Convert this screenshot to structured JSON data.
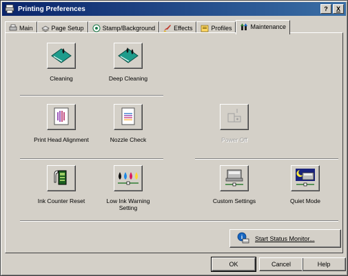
{
  "window": {
    "title": "Printing Preferences"
  },
  "title_buttons": {
    "help": "?",
    "close": "X"
  },
  "tabs": [
    {
      "label": "Main",
      "icon": "printer-icon"
    },
    {
      "label": "Page Setup",
      "icon": "pages-icon"
    },
    {
      "label": "Stamp/Background",
      "icon": "stamp-icon"
    },
    {
      "label": "Effects",
      "icon": "brush-icon"
    },
    {
      "label": "Profiles",
      "icon": "profiles-icon"
    },
    {
      "label": "Maintenance",
      "icon": "tools-icon",
      "active": true
    }
  ],
  "tools": {
    "cleaning": "Cleaning",
    "deep_cleaning": "Deep Cleaning",
    "print_head_alignment": "Print Head Alignment",
    "nozzle_check": "Nozzle Check",
    "power_off": "Power Off",
    "ink_counter_reset": "Ink Counter Reset",
    "low_ink_warning_line1": "Low Ink Warning",
    "low_ink_warning_line2": "Setting",
    "custom_settings": "Custom Settings",
    "quiet_mode": "Quiet Mode"
  },
  "status_monitor": {
    "label": "Start Status Monitor..."
  },
  "dialog_buttons": {
    "ok": "OK",
    "cancel": "Cancel",
    "help": "Help"
  },
  "colors": {
    "title_start": "#0a246a",
    "title_end": "#3a6ea5",
    "face": "#d4d0c8",
    "teal": "#1e9c8c"
  }
}
